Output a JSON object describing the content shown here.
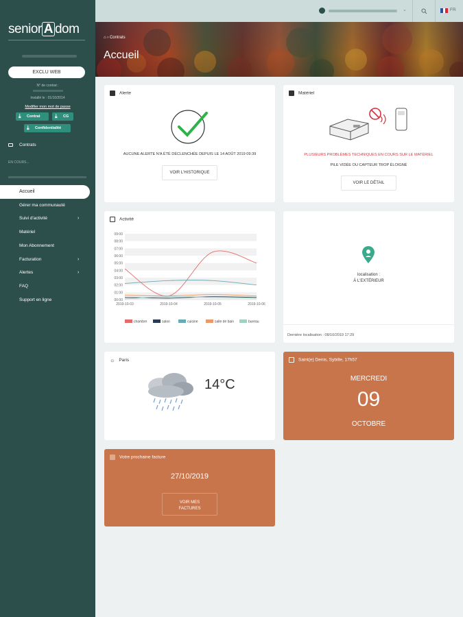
{
  "brand": {
    "logo_left": "senior",
    "logo_a": "A",
    "logo_right": "dom"
  },
  "sidebar": {
    "offer_label": "EXCLU WEB",
    "contract_number_label": "N° de contrat :",
    "install_label": "Installé le : 01/10/2014",
    "modify_link": "Modifier mon mot de passe",
    "downloads": {
      "contrat": "Contrat",
      "cg": "CG",
      "confidentialite": "Confidentialité"
    },
    "contracts_label": "Contrats",
    "in_progress_label": "EN COURS...",
    "items": {
      "accueil": "Accueil",
      "communaute": "Gérer ma communauté",
      "suivi": "Suivi d'activité",
      "materiel": "Matériel",
      "abonnement": "Mon Abonnement",
      "facturation": "Facturation",
      "alertes": "Alertes",
      "faq": "FAQ",
      "support": "Support en ligne"
    }
  },
  "topbar": {
    "lang": "FR"
  },
  "banner": {
    "crumb_contrats": "Contrats",
    "title": "Accueil"
  },
  "alerte": {
    "title": "Alerte",
    "message": "AUCUNE ALERTE N'A ÉTÉ DÉCLENCHÉE DEPUIS LE 14 AOÛT 2019 09:39",
    "button": "VOIR L'HISTORIQUE"
  },
  "materiel": {
    "title": "Matériel",
    "warning": "PLUSIEURS PROBLÈMES TECHNIQUES EN COURS SUR LE MATÉRIEL",
    "detail": "PILE VIDÉE OU CAPTEUR TROP ÉLOIGNÉ",
    "button": "VOIR LE DÉTAIL"
  },
  "activite": {
    "title": "Activité"
  },
  "chart_data": {
    "type": "line",
    "x": [
      "2019-10-03",
      "2019-10-04",
      "2019-10-05",
      "2019-10-06"
    ],
    "yticks": [
      "00:00",
      "01:00",
      "02:00",
      "03:00",
      "04:00",
      "05:00",
      "06:00",
      "07:00",
      "08:00",
      "09:00"
    ],
    "ylim": [
      0,
      9
    ],
    "series": [
      {
        "name": "chambre",
        "color": "#e06c6c",
        "values": [
          4.2,
          0.5,
          6.5,
          5.0
        ]
      },
      {
        "name": "salon",
        "color": "#2b3a55",
        "values": [
          0.3,
          0.2,
          0.4,
          0.3
        ]
      },
      {
        "name": "cuisine",
        "color": "#6aaab5",
        "values": [
          2.2,
          2.6,
          2.6,
          2.0
        ]
      },
      {
        "name": "salle de bain",
        "color": "#e89a6a",
        "values": [
          0.6,
          0.5,
          0.7,
          0.5
        ]
      },
      {
        "name": "bureau",
        "color": "#9ed3c0",
        "values": [
          0.1,
          0.4,
          0.3,
          0.2
        ]
      }
    ],
    "grid": true,
    "legend": "bottom"
  },
  "localisation": {
    "label": "localisation :",
    "value": "À L'EXTÉRIEUR",
    "last": "Dernière localisation : 08/10/2019 17:29"
  },
  "meteo": {
    "city": "Paris",
    "temp": "14°C"
  },
  "calendar": {
    "saint": "Saint(e) Denis, Sybille, 17h57",
    "weekday": "MERCREDI",
    "day": "09",
    "month": "OCTOBRE"
  },
  "facture": {
    "title": "Votre prochaine facture",
    "date": "27/10/2019",
    "button_line1": "VOIR MES",
    "button_line2": "FACTURES"
  }
}
